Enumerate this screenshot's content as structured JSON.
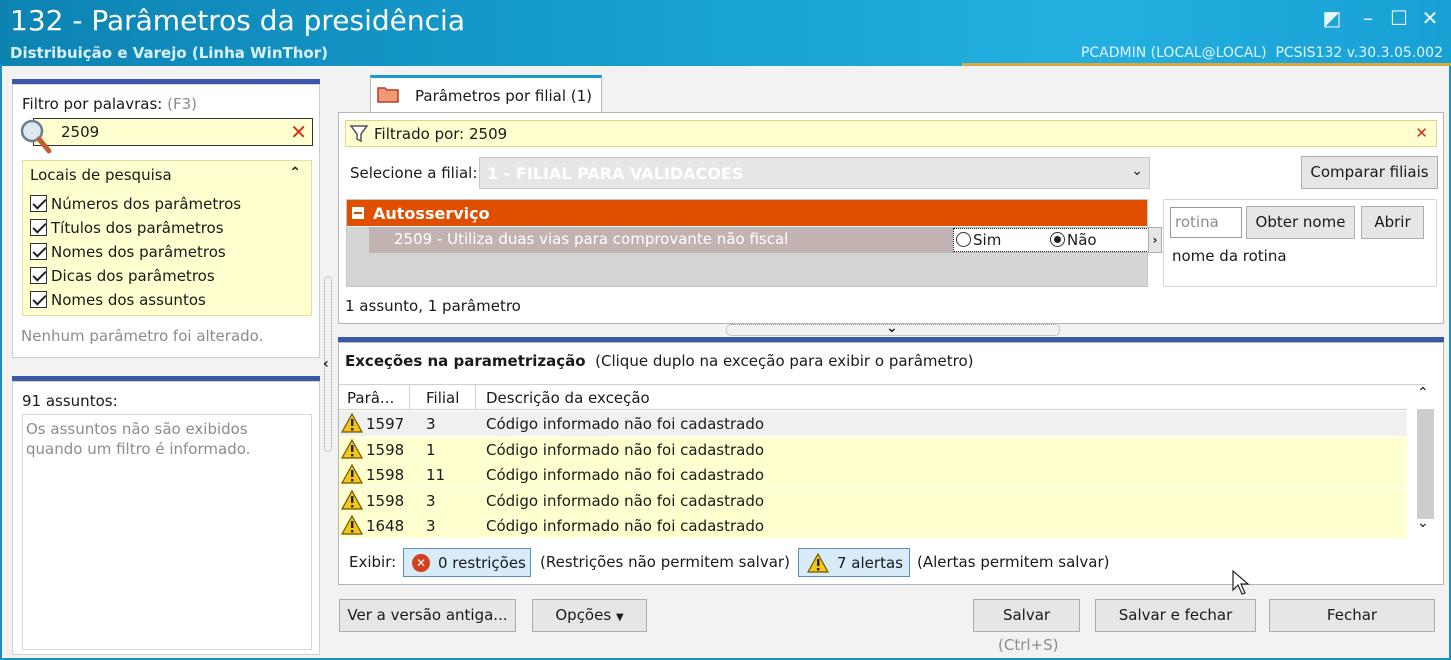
{
  "window": {
    "title": "132 - Parâmetros da presidência",
    "subtitle": "Distribuição e Varejo (Linha WinThor)",
    "user": "PCADMIN (LOCAL@LOCAL)",
    "program": "PCSIS132  v.30.3.05.002"
  },
  "filter": {
    "label": "Filtro por palavras:",
    "hint": "(F3)",
    "value": "2509"
  },
  "search_locations": {
    "title": "Locais de pesquisa",
    "items": [
      "Números dos parâmetros",
      "Títulos dos parâmetros",
      "Nomes dos parâmetros",
      "Dicas dos parâmetros",
      "Nomes dos assuntos"
    ]
  },
  "status_left": "Nenhum parâmetro foi alterado.",
  "subjects": {
    "title": "91 assuntos:",
    "note": "Os assuntos não são exibidos quando um filtro é informado."
  },
  "tab": {
    "label": "Parâmetros por filial  (1)"
  },
  "filtered": {
    "label": "Filtrado por: 2509"
  },
  "branch": {
    "label": "Selecione a filial:",
    "value": "1 - FILIAL PARA VALIDACOES",
    "compare_button": "Comparar filiais"
  },
  "group": {
    "title": "Autosserviço",
    "param": "2509 - Utiliza duas vias para comprovante não fiscal",
    "opt_yes": "Sim",
    "opt_no": "Não",
    "selected": "Não"
  },
  "routine": {
    "placeholder": "rotina",
    "get_name_button": "Obter nome",
    "open_button": "Abrir",
    "name_label": "nome da rotina"
  },
  "summary": "1 assunto, 1 parâmetro",
  "exceptions": {
    "title": "Exceções na parametrização",
    "hint": "(Clique duplo na exceção para exibir o parâmetro)",
    "columns": [
      "Parâ...",
      "Filial",
      "Descrição da exceção"
    ],
    "rows": [
      [
        "1597",
        "3",
        "Código informado não foi cadastrado"
      ],
      [
        "1598",
        "1",
        "Código informado não foi cadastrado"
      ],
      [
        "1598",
        "11",
        "Código informado não foi cadastrado"
      ],
      [
        "1598",
        "3",
        "Código informado não foi cadastrado"
      ],
      [
        "1648",
        "3",
        "Código informado não foi cadastrado"
      ]
    ]
  },
  "show": {
    "label": "Exibir:",
    "restrictions_button": "0 restrições",
    "restrictions_note": "(Restrições não permitem salvar)",
    "alerts_button": "7 alertas",
    "alerts_note": "(Alertas permitem salvar)"
  },
  "footer": {
    "old_version_button": "Ver a versão antiga...",
    "options_button": "Opções",
    "save_button": "Salvar",
    "save_shortcut": "(Ctrl+S)",
    "save_close_button": "Salvar e fechar",
    "close_button": "Fechar"
  },
  "colors": {
    "accent": "#1a9bd0",
    "group_header": "#e04f00",
    "param_row": "#c3b2b2",
    "highlight": "#ffffcf",
    "bluebar": "#3b57a5"
  }
}
